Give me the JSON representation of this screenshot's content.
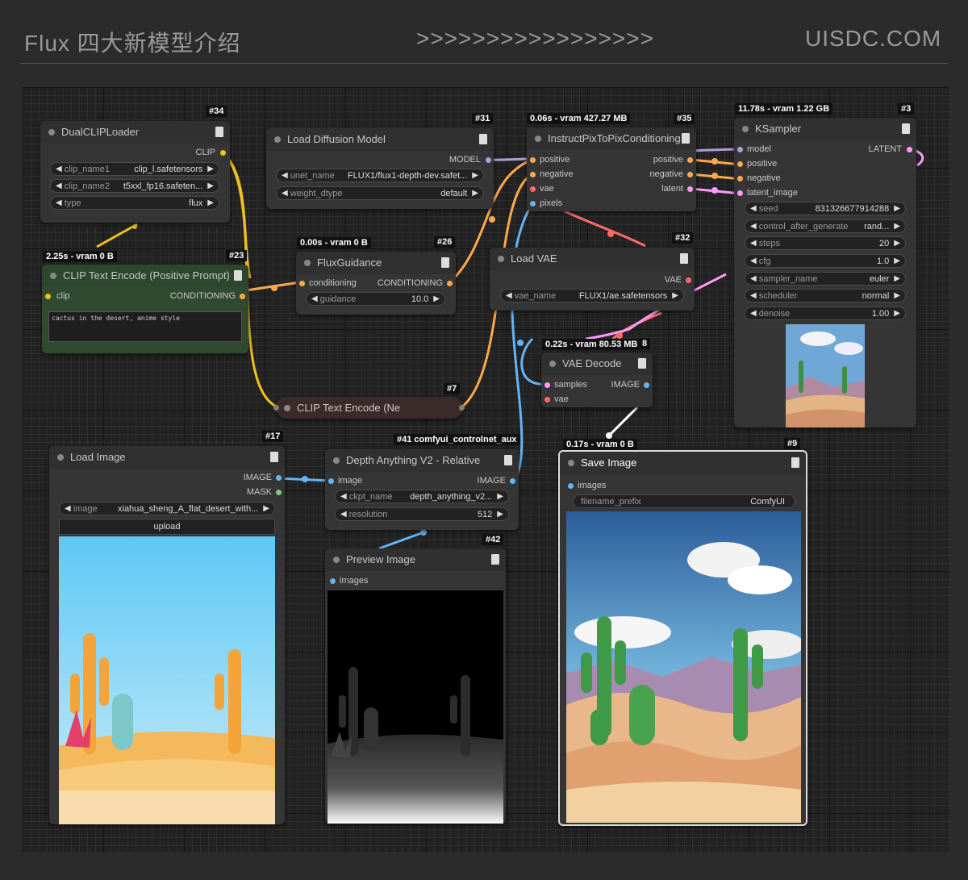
{
  "header": {
    "title": "Flux 四大新模型介绍",
    "arrows": ">>>>>>>>>>>>>>>>>",
    "site": "UISDC.COM"
  },
  "nodes": {
    "dualclip": {
      "id": "#34",
      "title": "DualCLIPLoader",
      "out_clip": "CLIP",
      "w1_name": "clip_name1",
      "w1_val": "clip_l.safetensors",
      "w2_name": "clip_name2",
      "w2_val": "t5xxl_fp16.safeten...",
      "w3_name": "type",
      "w3_val": "flux"
    },
    "loaddiff": {
      "id": "#31",
      "title": "Load Diffusion Model",
      "out_model": "MODEL",
      "w1_name": "unet_name",
      "w1_val": "FLUX1/flux1-depth-dev.safet...",
      "w2_name": "weight_dtype",
      "w2_val": "default"
    },
    "instruct": {
      "id": "#35",
      "stats": "0.06s - vram 427.27 MB",
      "title": "InstructPixToPixConditioning",
      "in_positive": "positive",
      "in_negative": "negative",
      "in_vae": "vae",
      "in_pixels": "pixels",
      "out_positive": "positive",
      "out_negative": "negative",
      "out_latent": "latent"
    },
    "ksampler": {
      "id": "#3",
      "stats": "11.78s - vram 1.22 GB",
      "title": "KSampler",
      "in_model": "model",
      "in_positive": "positive",
      "in_negative": "negative",
      "in_latent": "latent_image",
      "out_latent": "LATENT",
      "widgets": [
        {
          "name": "seed",
          "value": "831326677914288"
        },
        {
          "name": "control_after_generate",
          "value": "rand..."
        },
        {
          "name": "steps",
          "value": "20"
        },
        {
          "name": "cfg",
          "value": "1.0"
        },
        {
          "name": "sampler_name",
          "value": "euler"
        },
        {
          "name": "scheduler",
          "value": "normal"
        },
        {
          "name": "denoise",
          "value": "1.00"
        }
      ]
    },
    "clippos": {
      "id": "#23",
      "stats": "2.25s - vram 0 B",
      "title": "CLIP Text Encode (Positive Prompt)",
      "in_clip": "clip",
      "out_cond": "CONDITIONING",
      "text": "cactus in the desert, anime style"
    },
    "fluxguid": {
      "id": "#26",
      "stats": "0.00s - vram 0 B",
      "title": "FluxGuidance",
      "in_cond": "conditioning",
      "out_cond": "CONDITIONING",
      "w_name": "guidance",
      "w_val": "10.0"
    },
    "loadvae": {
      "id": "#32",
      "title": "Load VAE",
      "out_vae": "VAE",
      "w_name": "vae_name",
      "w_val": "FLUX1/ae.safetensors"
    },
    "vaedecode": {
      "id": "8",
      "stats": "0.22s - vram 80.53 MB",
      "title": "VAE Decode",
      "in_samples": "samples",
      "in_vae": "vae",
      "out_image": "IMAGE"
    },
    "clipneg": {
      "id": "#7",
      "title": "CLIP Text Encode (Ne"
    },
    "loadimage": {
      "id": "#17",
      "title": "Load Image",
      "out_image": "IMAGE",
      "out_mask": "MASK",
      "w_name": "image",
      "w_val": "xiahua_sheng_A_flat_desert_with...",
      "upload": "upload"
    },
    "depth": {
      "id": "#41 comfyui_controlnet_aux",
      "title": "Depth Anything V2 - Relative",
      "in_image": "image",
      "out_image": "IMAGE",
      "w1_name": "ckpt_name",
      "w1_val": "depth_anything_v2...",
      "w2_name": "resolution",
      "w2_val": "512"
    },
    "preview": {
      "id": "#42",
      "title": "Preview Image",
      "in_images": "images"
    },
    "save": {
      "id": "#9",
      "stats": "0.17s - vram 0 B",
      "title": "Save Image",
      "in_images": "images",
      "w_name": "filename_prefix",
      "w_val": "ComfyUI"
    }
  },
  "colors": {
    "clip": "#f0c020",
    "model": "#b39ddb",
    "cond": "#ffa94d",
    "vae": "#ff6b6b",
    "image": "#64b5f6",
    "latent": "#ff9cf9",
    "mask": "#81c784",
    "green_node": "#2f4a2f"
  }
}
